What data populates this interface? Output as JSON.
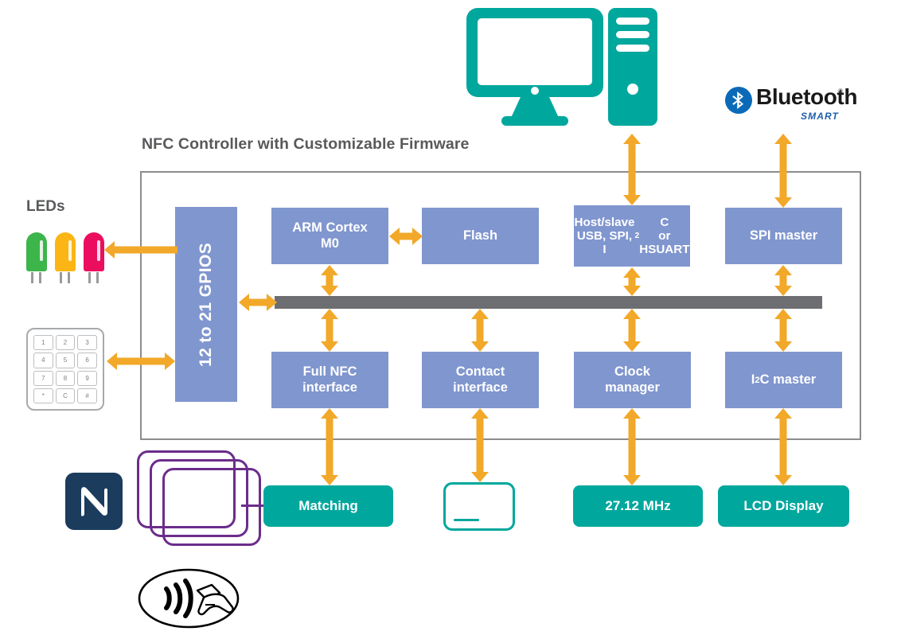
{
  "diagram": {
    "title": "NFC Controller with Customizable Firmware"
  },
  "blocks": {
    "gpios": "12 to 21 GPIOS",
    "arm": "ARM Cortex<br>M0",
    "arm_text": "ARM Cortex M0",
    "flash": "Flash",
    "host": "Host/slave<br>USB, SPI, I<sup>2</sup>C<br>or HSUART",
    "host_text": "Host/slave USB, SPI, I2C or HSUART",
    "spi_master": "SPI master",
    "full_nfc": "Full NFC<br>interface",
    "full_nfc_text": "Full NFC interface",
    "contact": "Contact<br>interface",
    "contact_text": "Contact interface",
    "clock_manager": "Clock<br>manager",
    "clock_manager_text": "Clock manager",
    "i2c_master": "I<sup>2</sup>C master",
    "i2c_master_text": "I2C master"
  },
  "peripherals": {
    "matching": "Matching",
    "clock_frequency": "27.12 MHz",
    "lcd_display": "LCD Display",
    "smart_card": "smart-card-icon"
  },
  "labels": {
    "leds": "LEDs"
  },
  "keypad": {
    "keys": [
      "1",
      "2",
      "3",
      "4",
      "5",
      "6",
      "7",
      "8",
      "9",
      "*",
      "C",
      "#"
    ]
  },
  "leds": [
    {
      "name": "green-led",
      "color": "#3cb54a"
    },
    {
      "name": "amber-led",
      "color": "#fbb615"
    },
    {
      "name": "magenta-led",
      "color": "#ec0e5e"
    }
  ],
  "bluetooth": {
    "wordmark": "Bluetooth",
    "registered": "®",
    "sub": "SMART"
  },
  "icons": {
    "computer": "desktop-computer-icon",
    "nfc_logo": "nfc-logo-icon",
    "antenna": "nfc-antenna-coil-icon",
    "contactless": "contactless-payment-icon",
    "bluetooth_badge": "bluetooth-logo-icon"
  },
  "colors": {
    "block_blue": "#8096cf",
    "teal": "#00a79d",
    "arrow_orange": "#f2a829",
    "bus_gray": "#6d6e71",
    "frame_gray": "#8c8c8c",
    "coil_purple": "#6b2d8b",
    "nfc_navy": "#1b3c5d",
    "text_gray": "#58595b",
    "bt_blue": "#1f5fa9"
  }
}
